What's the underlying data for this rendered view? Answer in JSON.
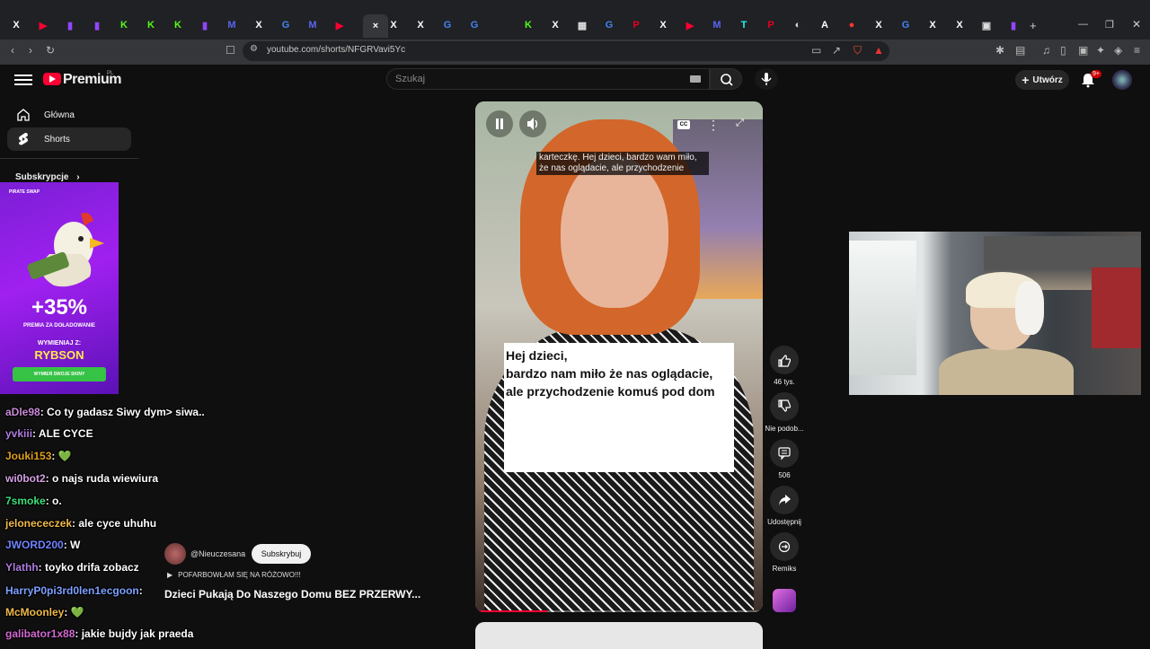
{
  "browser": {
    "url": "youtube.com/shorts/NFGRVavi5Yc",
    "tabs": [
      "X",
      "YT",
      "TW",
      "TW",
      "K",
      "K",
      "K",
      "TW",
      "M",
      "X",
      "G",
      "M",
      "YT",
      "×",
      "X",
      "X",
      "G",
      "G",
      "",
      "K",
      "X",
      "▦",
      "G",
      "P",
      "X",
      "YT",
      "M",
      "T",
      "P",
      "◐",
      "A",
      "●",
      "X",
      "G",
      "X",
      "X",
      "▣",
      "TW",
      "K"
    ]
  },
  "header": {
    "logo_text": "Premium",
    "country": "PL",
    "search_placeholder": "Szukaj",
    "create_label": "Utwórz",
    "notifications_badge": "9+"
  },
  "sidebar": {
    "items": [
      {
        "label": "Główna",
        "icon": "home-icon"
      },
      {
        "label": "Shorts",
        "icon": "shorts-icon"
      }
    ],
    "subscriptions_label": "Subskrypcje"
  },
  "ad": {
    "brand": "PIRATE SWAP",
    "percent": "+35%",
    "line1": "PREMIA ZA DOŁADOWANIE",
    "line2": "WYMIENIAJ Z:",
    "name": "RYBSON",
    "button": "WYMIEŃ SWOJE SKINY"
  },
  "chat": [
    {
      "user": "aDle98",
      "color": "#c88ad8",
      "msg": ": Co ty gadasz Siwy dym> siwa.."
    },
    {
      "user": "yvkiii",
      "color": "#b07de0",
      "msg": ": ALE CYCE"
    },
    {
      "user": "Jouki153",
      "color": "#e0a020",
      "msg": ": 💚"
    },
    {
      "user": "wi0bot2",
      "color": "#d6a0e6",
      "msg": ": o najs ruda wiewiura"
    },
    {
      "user": "7smoke",
      "color": "#3ce07a",
      "msg": ": o."
    },
    {
      "user": "jelonececzek",
      "color": "#f0b94a",
      "msg": ": ale cyce uhuhu"
    },
    {
      "user": "JWORD200",
      "color": "#6f84ff",
      "msg": ": W"
    },
    {
      "user": "Ylathh",
      "color": "#b07de0",
      "msg": ": toyko drifa zobacz"
    },
    {
      "user": "HarryP0pi3rd0len1ecgoon",
      "color": "#7da0ff",
      "msg": ": "
    },
    {
      "user": "McMoonley",
      "color": "#f0b94a",
      "msg": ": 💚"
    },
    {
      "user": "galibator1x88",
      "color": "#d26ad2",
      "msg": ": jakie bujdy jak praeda"
    }
  ],
  "video": {
    "caption_line1": "karteczkę. Hej dzieci, bardzo wam miło,",
    "caption_line2": "że nas oglądacie, ale przychodzenie",
    "card_line1": "Hej dzieci,",
    "card_line2": "bardzo nam miło że nas oglądacie,",
    "card_line3": "ale przychodzenie komuś pod dom",
    "progress": 0.25,
    "channel": "@Nieuczesana",
    "subscribe_label": "Subskrybuj",
    "sound": "POFARBOWŁAM SIĘ NA RÓŻOWO!!!",
    "title": "Dzieci Pukają Do Naszego Domu BEZ PRZERWY..."
  },
  "actions": [
    {
      "icon": "thumbs-up-icon",
      "label": "46 tys."
    },
    {
      "icon": "thumbs-down-icon",
      "label": "Nie podob..."
    },
    {
      "icon": "comment-icon",
      "label": "506"
    },
    {
      "icon": "share-icon",
      "label": "Udostępnij"
    },
    {
      "icon": "remix-icon",
      "label": "Remiks"
    }
  ],
  "colors": {
    "youtube_red": "#ff0033",
    "background": "#0f0f0f",
    "ad_purple": "#a020f0"
  }
}
